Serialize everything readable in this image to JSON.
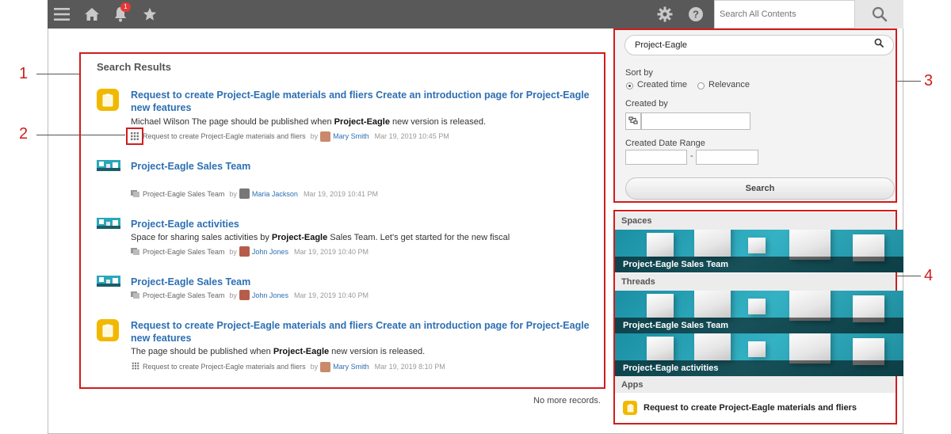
{
  "topbar": {
    "notification_count": "1",
    "search_placeholder": "Search All Contents"
  },
  "callouts": [
    "1",
    "2",
    "3",
    "4"
  ],
  "results": {
    "title": "Search Results",
    "items": [
      {
        "icon": "app-icon",
        "title": "Request to create Project-Eagle materials and fliers Create an introduction page for Project-Eagle new features",
        "desc_pre": "Michael Wilson The page should be published when ",
        "desc_bold": "Project-Eagle",
        "desc_post": " new version is released.",
        "location": "Request to create Project-Eagle materials and fliers",
        "by": "by",
        "user": "Mary Smith",
        "date": "Mar 19, 2019 10:45 PM"
      },
      {
        "icon": "space-icon",
        "title": "Project-Eagle Sales Team",
        "desc_pre": "",
        "desc_bold": "",
        "desc_post": "",
        "location": "Project-Eagle Sales Team",
        "by": "by",
        "user": "Maria Jackson",
        "date": "Mar 19, 2019 10:41 PM"
      },
      {
        "icon": "space-icon",
        "title": "Project-Eagle activities",
        "desc_pre": "Space for sharing sales activities by ",
        "desc_bold": "Project-Eagle",
        "desc_post": " Sales Team. Let's get started for the new fiscal",
        "location": "Project-Eagle Sales Team",
        "by": "by",
        "user": "John Jones",
        "date": "Mar 19, 2019 10:40 PM"
      },
      {
        "icon": "space-icon",
        "title": "Project-Eagle Sales Team",
        "desc_pre": "",
        "desc_bold": "",
        "desc_post": "",
        "location": "Project-Eagle Sales Team",
        "by": "by",
        "user": "John Jones",
        "date": "Mar 19, 2019 10:40 PM"
      },
      {
        "icon": "app-icon",
        "title": "Request to create Project-Eagle materials and fliers Create an introduction page for Project-Eagle new features",
        "desc_pre": "The page should be published when ",
        "desc_bold": "Project-Eagle",
        "desc_post": " new version is released.",
        "location": "Request to create Project-Eagle materials and fliers",
        "by": "by",
        "user": "Mary Smith",
        "date": "Mar 19, 2019 8:10 PM"
      }
    ],
    "no_more": "No more records."
  },
  "filter": {
    "query": "Project-Eagle",
    "sort_label": "Sort by",
    "sort_options": [
      "Created time",
      "Relevance"
    ],
    "sort_selected": "Created time",
    "created_by_label": "Created by",
    "created_by_value": "",
    "date_range_label": "Created Date Range",
    "date_from": "",
    "date_separator": "-",
    "date_to": "",
    "search_button": "Search"
  },
  "sidebar": {
    "spaces_heading": "Spaces",
    "spaces": [
      "Project-Eagle Sales Team"
    ],
    "threads_heading": "Threads",
    "threads": [
      "Project-Eagle Sales Team",
      "Project-Eagle activities"
    ],
    "apps_heading": "Apps",
    "apps": [
      "Request to create Project-Eagle materials and fliers"
    ]
  },
  "colors": {
    "accent_link": "#2d6fb3",
    "callout_red": "#d01d1d",
    "topbar": "#595959",
    "app_yellow": "#f2b800"
  }
}
